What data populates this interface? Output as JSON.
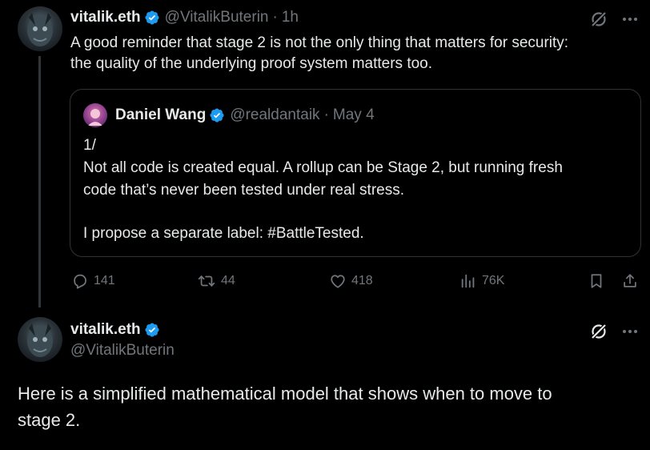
{
  "tweet1": {
    "display_name": "vitalik.eth",
    "handle": "@VitalikButerin",
    "separator": "·",
    "time": "1h",
    "text_line1": "A good reminder that stage 2 is not the only thing that matters for security:",
    "text_line2": "the quality of the underlying proof system matters too.",
    "quote": {
      "display_name": "Daniel Wang",
      "handle": "@realdantaik",
      "separator": "·",
      "date": "May 4",
      "line1": "1/",
      "line2": "Not all code is created equal. A rollup can be Stage 2, but running fresh",
      "line3": "code that’s never been tested under real stress.",
      "line4": "I propose a separate label: #BattleTested."
    },
    "actions": {
      "replies": "141",
      "reposts": "44",
      "likes": "418",
      "views": "76K"
    }
  },
  "tweet2": {
    "display_name": "vitalik.eth",
    "handle": "@VitalikButerin",
    "text_line1": "Here is a simplified mathematical model that shows when to move to",
    "text_line2": "stage 2."
  },
  "colors": {
    "background": "#000000",
    "text": "#e7e9ea",
    "muted": "#71767b",
    "verified": "#1d9bf0",
    "border": "#2f3336"
  },
  "icons": [
    "grok-icon",
    "more-icon",
    "verified-icon",
    "reply-icon",
    "repost-icon",
    "like-icon",
    "views-icon",
    "bookmark-icon",
    "share-icon"
  ]
}
